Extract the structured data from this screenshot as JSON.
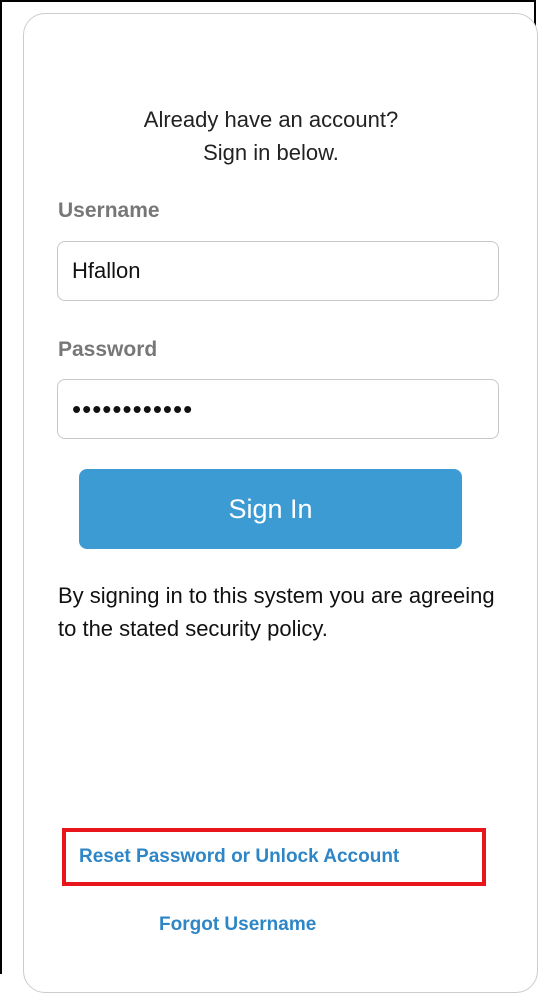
{
  "signin": {
    "heading_line1": "Already have an account?",
    "heading_line2": "Sign in below.",
    "username_label": "Username",
    "username_value": "Hfallon",
    "password_label": "Password",
    "password_value": "••••••••••••",
    "button_label": "Sign In",
    "policy_text": "By signing in to this system you are agreeing to the stated security policy."
  },
  "links": {
    "reset": "Reset Password or Unlock Account",
    "forgot_username": "Forgot Username"
  },
  "colors": {
    "button": "#3d9bd3",
    "link": "#2f86c6",
    "highlight": "#e8151b",
    "label": "#777777"
  }
}
